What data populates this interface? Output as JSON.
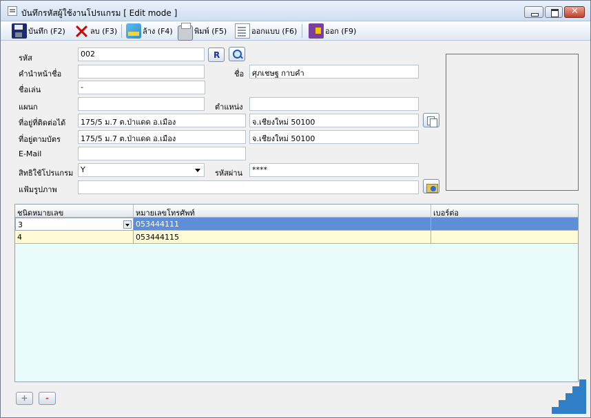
{
  "window": {
    "title": "บันทึกรหัสผู้ใช้งานโปรแกรม [ Edit mode ]"
  },
  "toolbar": {
    "save_label": "บันทึก (F2)",
    "delete_label": "ลบ (F3)",
    "clear_label": "ล้าง (F4)",
    "print_label": "พิมพ์ (F5)",
    "design_label": "ออกแบบ (F6)",
    "exit_label": "ออก (F9)"
  },
  "form": {
    "code_label": "รหัส",
    "code_value": "002",
    "r_button": "R",
    "prefix_label": "คำนำหน้าชื่อ",
    "prefix_value": "",
    "name_label": "ชื่อ",
    "name_value": "ศุภเชษฐ กาบคำ",
    "nickname_label": "ชื่อเล่น",
    "nickname_value": "-",
    "department_label": "แผนก",
    "department_value": "",
    "position_label": "ตำแหน่ง",
    "position_value": "",
    "contact_address_label": "ที่อยู่ที่ติดต่อได้",
    "contact_address_1": "175/5 ม.7 ต.ป่าแดด อ.เมือง",
    "contact_address_2": "จ.เชียงใหม่ 50100",
    "card_address_label": "ที่อยู่ตามบัตร",
    "card_address_1": "175/5 ม.7 ต.ป่าแดด อ.เมือง",
    "card_address_2": "จ.เชียงใหม่ 50100",
    "email_label": "E-Mail",
    "email_value": "",
    "permission_label": "สิทธิใช้โปรแกรม",
    "permission_value": "Y",
    "password_label": "รหัสผ่าน",
    "password_value": "****",
    "photo_label": "แฟ้มรูปภาพ",
    "photo_value": ""
  },
  "grid": {
    "columns": [
      "ชนิดหมายเลข",
      "หมายเลขโทรศัพท์",
      "เบอร์ต่อ"
    ],
    "rows": [
      {
        "type": "3",
        "phone": "053444111",
        "ext": ""
      },
      {
        "type": "4",
        "phone": "053444115",
        "ext": ""
      }
    ]
  },
  "nav": {
    "add_label": "+",
    "remove_label": "-"
  },
  "colors": {
    "selected_row": "#5e8ed8",
    "alt_row": "#fffbd4",
    "grid_bg": "#e9fbfb"
  }
}
